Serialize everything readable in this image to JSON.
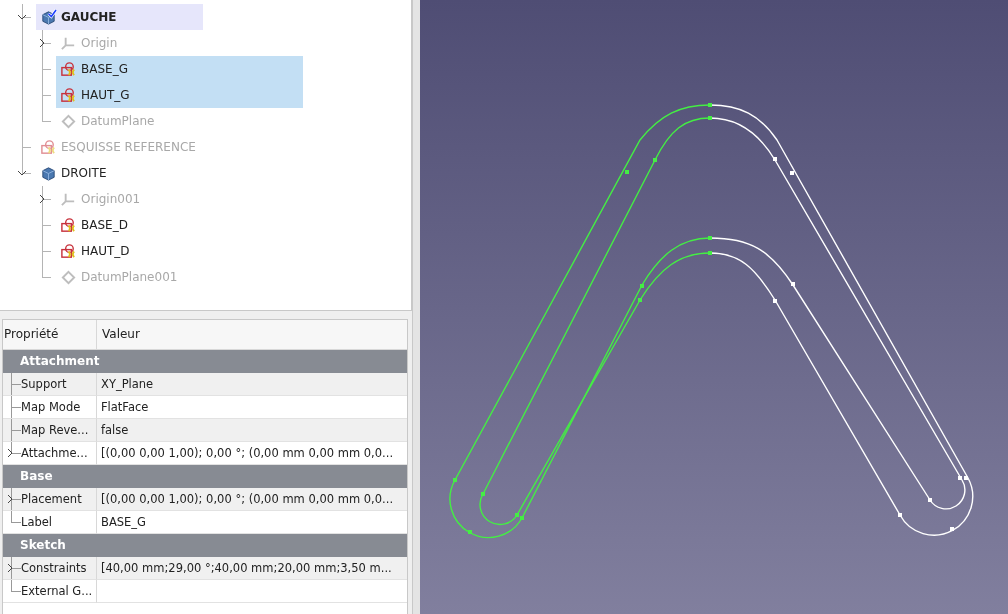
{
  "tree": [
    {
      "label": "GAUCHE",
      "kind": "body",
      "active": true,
      "selected": false,
      "visible": true,
      "expanded": true,
      "children": [
        {
          "label": "Origin",
          "kind": "origin",
          "active": false,
          "selected": false,
          "visible": false,
          "expanded": false
        },
        {
          "label": "BASE_G",
          "kind": "sketch",
          "active": false,
          "selected": true,
          "visible": true
        },
        {
          "label": "HAUT_G",
          "kind": "sketch",
          "active": false,
          "selected": true,
          "visible": true
        },
        {
          "label": "DatumPlane",
          "kind": "datum",
          "active": false,
          "selected": false,
          "visible": false
        }
      ]
    },
    {
      "label": "ESQUISSE REFERENCE",
      "kind": "sketch",
      "active": false,
      "selected": false,
      "visible": false
    },
    {
      "label": "DROITE",
      "kind": "body",
      "active": false,
      "selected": false,
      "visible": true,
      "expanded": true,
      "children": [
        {
          "label": "Origin001",
          "kind": "origin",
          "active": false,
          "selected": false,
          "visible": false,
          "expanded": false
        },
        {
          "label": "BASE_D",
          "kind": "sketch",
          "active": false,
          "selected": false,
          "visible": true
        },
        {
          "label": "HAUT_D",
          "kind": "sketch",
          "active": false,
          "selected": false,
          "visible": true
        },
        {
          "label": "DatumPlane001",
          "kind": "datum",
          "active": false,
          "selected": false,
          "visible": false
        }
      ]
    }
  ],
  "properties": {
    "columns": [
      "Propriété",
      "Valeur"
    ],
    "groups": [
      {
        "name": "Attachment",
        "rows": [
          {
            "property": "Support",
            "value": "XY_Plane",
            "expandable": false
          },
          {
            "property": "Map Mode",
            "value": "FlatFace",
            "expandable": false
          },
          {
            "property": "Map Reve...",
            "value": "false",
            "expandable": false
          },
          {
            "property": "Attachme...",
            "value": "[(0,00 0,00 1,00); 0,00 °; (0,00 mm  0,00 mm  0,0...",
            "expandable": true
          }
        ]
      },
      {
        "name": "Base",
        "rows": [
          {
            "property": "Placement",
            "value": "[(0,00 0,00 1,00); 0,00 °; (0,00 mm  0,00 mm  0,0...",
            "expandable": true
          },
          {
            "property": "Label",
            "value": "BASE_G",
            "expandable": false
          }
        ]
      },
      {
        "name": "Sketch",
        "rows": [
          {
            "property": "Constraints",
            "value": "[40,00 mm;29,00 °;40,00 mm;20,00 mm;3,50 m...",
            "expandable": true
          },
          {
            "property": "External G...",
            "value": "",
            "expandable": false
          }
        ]
      }
    ]
  }
}
